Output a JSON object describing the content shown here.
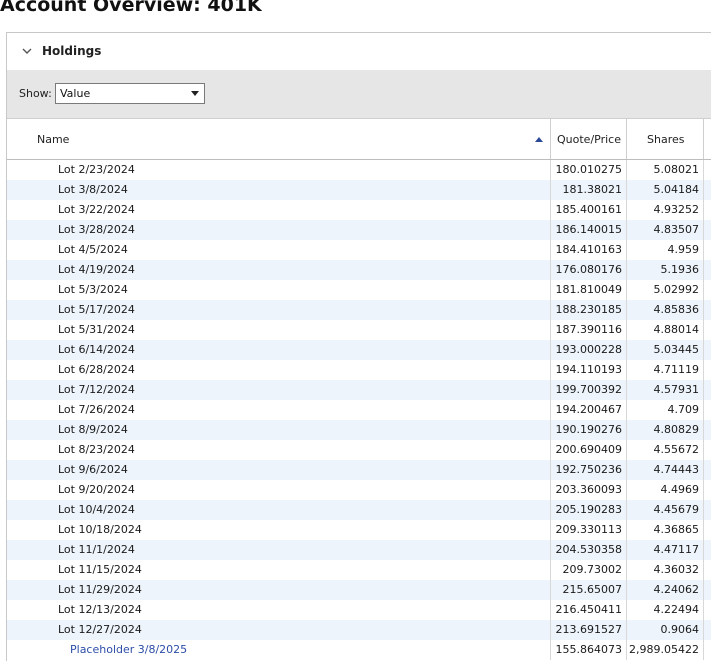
{
  "page": {
    "title": "Account Overview: 401K"
  },
  "holdings": {
    "section_title": "Holdings",
    "show_label": "Show:",
    "show_value": "Value",
    "columns": {
      "name": "Name",
      "price": "Quote/Price",
      "shares": "Shares"
    },
    "rows": [
      {
        "name": "Lot 2/23/2024",
        "price": "180.010275",
        "shares": "5.08021"
      },
      {
        "name": "Lot 3/8/2024",
        "price": "181.38021",
        "shares": "5.04184"
      },
      {
        "name": "Lot 3/22/2024",
        "price": "185.400161",
        "shares": "4.93252"
      },
      {
        "name": "Lot 3/28/2024",
        "price": "186.140015",
        "shares": "4.83507"
      },
      {
        "name": "Lot 4/5/2024",
        "price": "184.410163",
        "shares": "4.959"
      },
      {
        "name": "Lot 4/19/2024",
        "price": "176.080176",
        "shares": "5.1936"
      },
      {
        "name": "Lot 5/3/2024",
        "price": "181.810049",
        "shares": "5.02992"
      },
      {
        "name": "Lot 5/17/2024",
        "price": "188.230185",
        "shares": "4.85836"
      },
      {
        "name": "Lot 5/31/2024",
        "price": "187.390116",
        "shares": "4.88014"
      },
      {
        "name": "Lot 6/14/2024",
        "price": "193.000228",
        "shares": "5.03445"
      },
      {
        "name": "Lot 6/28/2024",
        "price": "194.110193",
        "shares": "4.71119"
      },
      {
        "name": "Lot 7/12/2024",
        "price": "199.700392",
        "shares": "4.57931"
      },
      {
        "name": "Lot 7/26/2024",
        "price": "194.200467",
        "shares": "4.709"
      },
      {
        "name": "Lot 8/9/2024",
        "price": "190.190276",
        "shares": "4.80829"
      },
      {
        "name": "Lot 8/23/2024",
        "price": "200.690409",
        "shares": "4.55672"
      },
      {
        "name": "Lot 9/6/2024",
        "price": "192.750236",
        "shares": "4.74443"
      },
      {
        "name": "Lot 9/20/2024",
        "price": "203.360093",
        "shares": "4.4969"
      },
      {
        "name": "Lot 10/4/2024",
        "price": "205.190283",
        "shares": "4.45679"
      },
      {
        "name": "Lot 10/18/2024",
        "price": "209.330113",
        "shares": "4.36865"
      },
      {
        "name": "Lot 11/1/2024",
        "price": "204.530358",
        "shares": "4.47117"
      },
      {
        "name": "Lot 11/15/2024",
        "price": "209.73002",
        "shares": "4.36032"
      },
      {
        "name": "Lot 11/29/2024",
        "price": "215.65007",
        "shares": "4.24062"
      },
      {
        "name": "Lot 12/13/2024",
        "price": "216.450411",
        "shares": "4.22494"
      },
      {
        "name": "Lot 12/27/2024",
        "price": "213.691527",
        "shares": "0.9064"
      },
      {
        "name": "Placeholder 3/8/2025",
        "price": "155.864073",
        "shares": "2,989.05422",
        "placeholder": true
      }
    ]
  },
  "icons": {
    "collapse": "chevron-down-icon",
    "sort": "sort-ascending-icon",
    "dropdown": "dropdown-arrow-icon"
  },
  "colors": {
    "row_alt": "#edf4fb",
    "placeholder_text": "#2d4ea8",
    "toolbar_bg": "#e6e6e6"
  }
}
